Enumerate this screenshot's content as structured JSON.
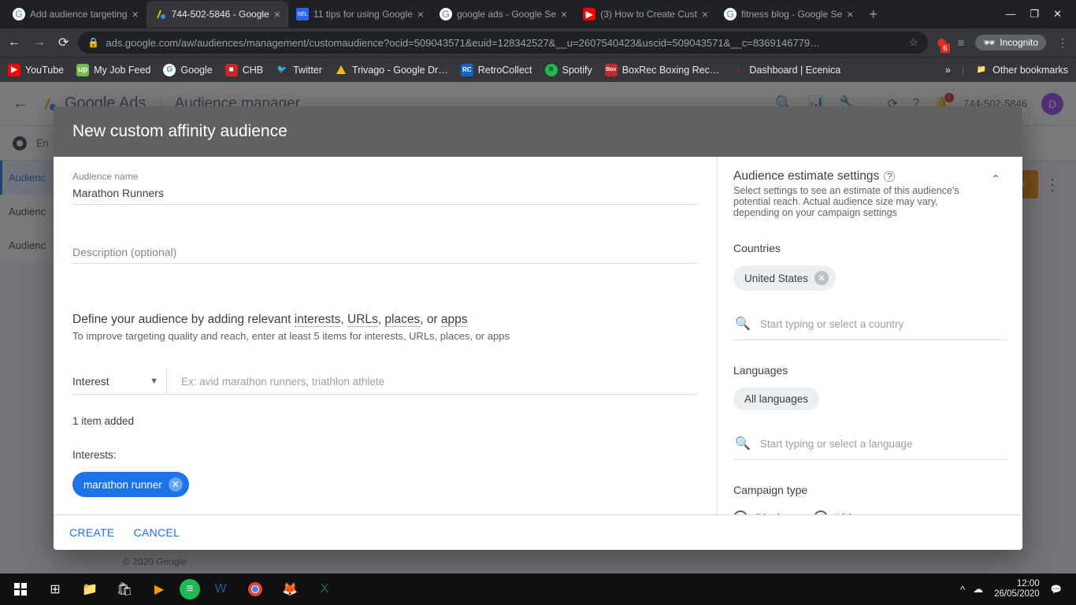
{
  "browser": {
    "tabs": [
      {
        "title": "Add audience targeting",
        "icon": "G",
        "iconbg": "#fff",
        "iconcolor": "#4285f4"
      },
      {
        "title": "744-502-5846 - Google",
        "icon": "▲",
        "iconbg": "transparent",
        "iconcolor": "#fbbc04"
      },
      {
        "title": "11 tips for using Google",
        "icon": "SEL",
        "iconbg": "#2962ff",
        "iconcolor": "#fff"
      },
      {
        "title": "google ads - Google Se",
        "icon": "G",
        "iconbg": "#fff",
        "iconcolor": "#4285f4"
      },
      {
        "title": "(3) How to Create Cust",
        "icon": "▶",
        "iconbg": "#ff0000",
        "iconcolor": "#fff"
      },
      {
        "title": "fitness blog - Google Se",
        "icon": "G",
        "iconbg": "#fff",
        "iconcolor": "#4285f4"
      }
    ],
    "url": "ads.google.com/aw/audiences/management/customaudience?ocid=509043571&euid=128342527&__u=2607540423&uscid=509043571&__c=8369146779…",
    "incognito": "Incognito",
    "bookmarks": [
      {
        "label": "YouTube",
        "iconbg": "#ff0000",
        "iconcolor": "#fff",
        "glyph": "▶"
      },
      {
        "label": "My Job Feed",
        "iconbg": "#6fbf44",
        "iconcolor": "#fff",
        "glyph": "up"
      },
      {
        "label": "Google",
        "iconbg": "#fff",
        "iconcolor": "#4285f4",
        "glyph": "G"
      },
      {
        "label": "CHB",
        "iconbg": "#c62828",
        "iconcolor": "#fff",
        "glyph": "■"
      },
      {
        "label": "Twitter",
        "iconbg": "transparent",
        "iconcolor": "#1da1f2",
        "glyph": "🐦"
      },
      {
        "label": "Trivago - Google Dr…",
        "iconbg": "transparent",
        "iconcolor": "#fbbc04",
        "glyph": "▲"
      },
      {
        "label": "RetroCollect",
        "iconbg": "#1565c0",
        "iconcolor": "#fff",
        "glyph": "RC"
      },
      {
        "label": "Spotify",
        "iconbg": "#1db954",
        "iconcolor": "#000",
        "glyph": "●"
      },
      {
        "label": "BoxRec Boxing Rec…",
        "iconbg": "#c62828",
        "iconcolor": "#fff",
        "glyph": "Box"
      },
      {
        "label": "Dashboard | Ecenica",
        "iconbg": "#c2185b",
        "iconcolor": "#fff",
        "glyph": "◐"
      }
    ],
    "other_bookmarks": "Other bookmarks"
  },
  "gads": {
    "logo": "Google Ads",
    "section": "Audience manager",
    "account": "744-502-5846",
    "avatar": "D",
    "subheader_text": "En",
    "sidemenu": [
      "Audienc",
      "Audienc",
      "Audienc"
    ],
    "footer": "© 2020 Google"
  },
  "dialog": {
    "title": "New custom affinity audience",
    "audience_name_label": "Audience name",
    "audience_name_value": "Marathon Runners",
    "description_placeholder": "Description (optional)",
    "define_prefix": "Define your audience by adding relevant ",
    "define_links": {
      "interests": "interests",
      "urls": "URLs",
      "places": "places",
      "apps": "apps",
      "sep_comma": ", ",
      "sep_or": ", or "
    },
    "define_sub": "To improve targeting quality and reach, enter at least 5 items for interests, URLs, places, or apps",
    "interest_select_label": "Interest",
    "interest_placeholder": "Ex: avid marathon runners, triathlon athlete",
    "items_added": "1 item added",
    "interests_label": "Interests:",
    "chip": "marathon runner",
    "create": "CREATE",
    "cancel": "CANCEL"
  },
  "estimate": {
    "title": "Audience estimate settings",
    "sub": "Select settings to see an estimate of this audience's potential reach. Actual audience size may vary, depending on your campaign settings",
    "countries_label": "Countries",
    "country_chip": "United States",
    "country_placeholder": "Start typing or select a country",
    "languages_label": "Languages",
    "language_chip": "All languages",
    "language_placeholder": "Start typing or select a language",
    "campaign_type_label": "Campaign type",
    "radio_display": "Display",
    "radio_video": "Video"
  },
  "taskbar": {
    "time": "12:00",
    "date": "26/05/2020"
  }
}
